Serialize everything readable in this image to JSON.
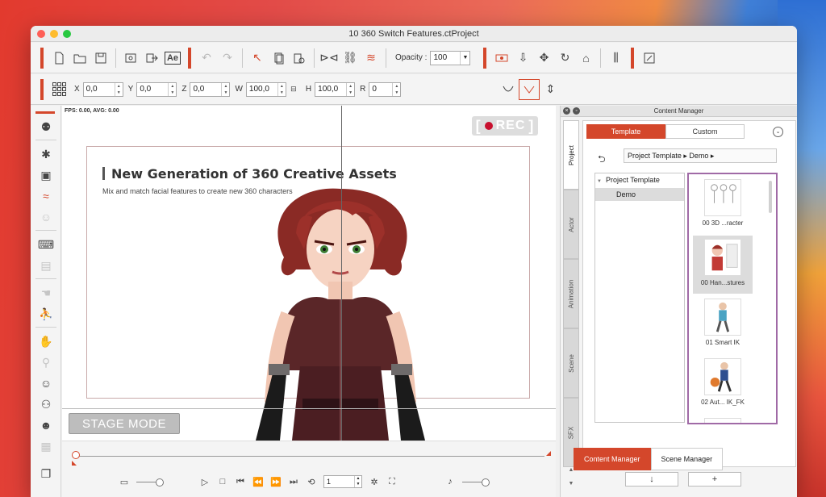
{
  "window": {
    "title": "10 360 Switch Features.ctProject"
  },
  "toolbar": {
    "opacity_label": "Opacity :",
    "opacity_value": "100"
  },
  "transform": {
    "x_label": "X",
    "x_value": "0,0",
    "y_label": "Y",
    "y_value": "0,0",
    "z_label": "Z",
    "z_value": "0,0",
    "w_label": "W",
    "w_value": "100,0",
    "h_label": "H",
    "h_value": "100,0",
    "r_label": "R",
    "r_value": "0"
  },
  "viewport": {
    "fps_text": "FPS: 0.00, AVG: 0.00",
    "rec_label": "REC",
    "slide_title": "New Generation of 360 Creative Assets",
    "slide_subtitle": "Mix and match facial features to create new 360 characters",
    "stage_mode_label": "STAGE MODE"
  },
  "timeline": {
    "frame_value": "1"
  },
  "content_manager": {
    "title": "Content Manager",
    "vertical_tabs": [
      "Project",
      "Actor",
      "Animation",
      "Scene",
      "SFX"
    ],
    "top_tabs": [
      "Template",
      "Custom"
    ],
    "path": "Project Template ▸ Demo ▸",
    "tree_root": "Project Template",
    "tree_child": "Demo",
    "thumbs": [
      "00 3D ...racter",
      "00 Han...stures",
      "01 Smart IK",
      "02 Aut... IK_FK"
    ],
    "download_button": "↓",
    "add_button": "+"
  },
  "bottom_tabs": [
    "Content Manager",
    "Scene Manager"
  ]
}
